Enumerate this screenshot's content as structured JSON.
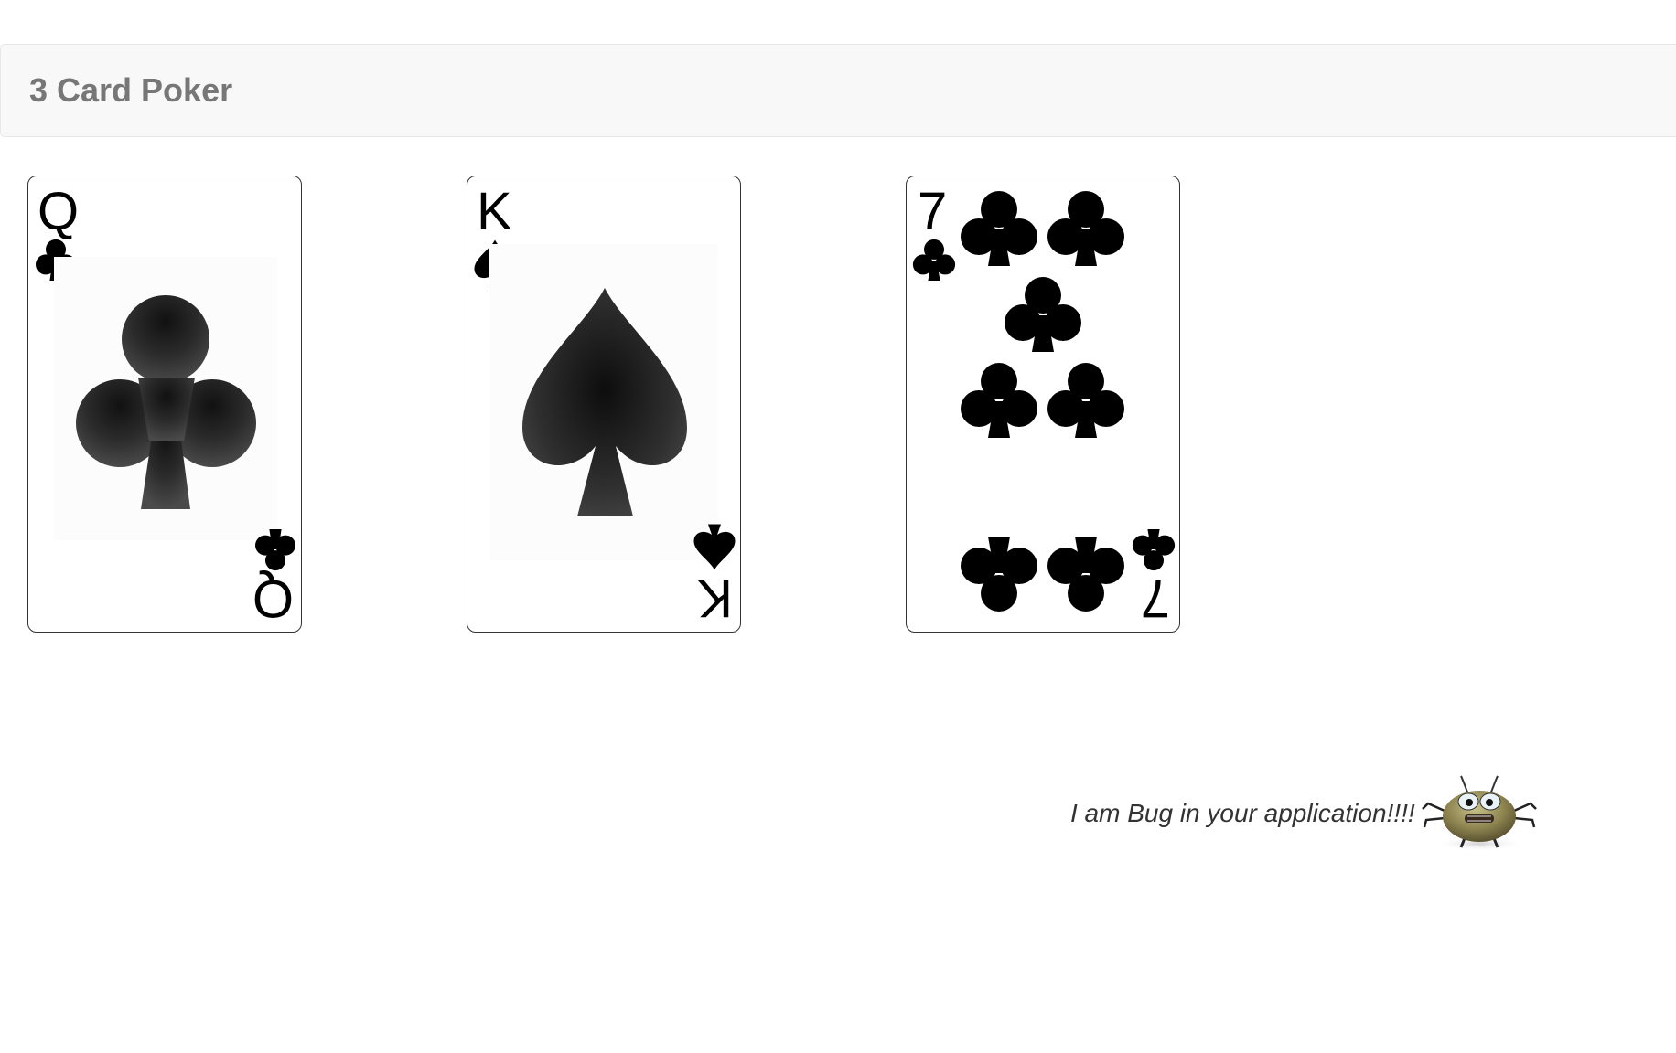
{
  "navbar": {
    "brand": "3 Card Poker"
  },
  "cards": [
    {
      "rank": "Q",
      "suit": "clubs",
      "suit_icon": "club-icon",
      "rank_color": "#000000",
      "pips": 1
    },
    {
      "rank": "K",
      "suit": "spades",
      "suit_icon": "spade-icon",
      "rank_color": "#000000",
      "pips": 1
    },
    {
      "rank": "7",
      "suit": "clubs",
      "suit_icon": "club-icon",
      "rank_color": "#000000",
      "pips": 7
    }
  ],
  "footer": {
    "message": "I am Bug in your application!!!!",
    "mascot_icon": "bug-icon"
  }
}
